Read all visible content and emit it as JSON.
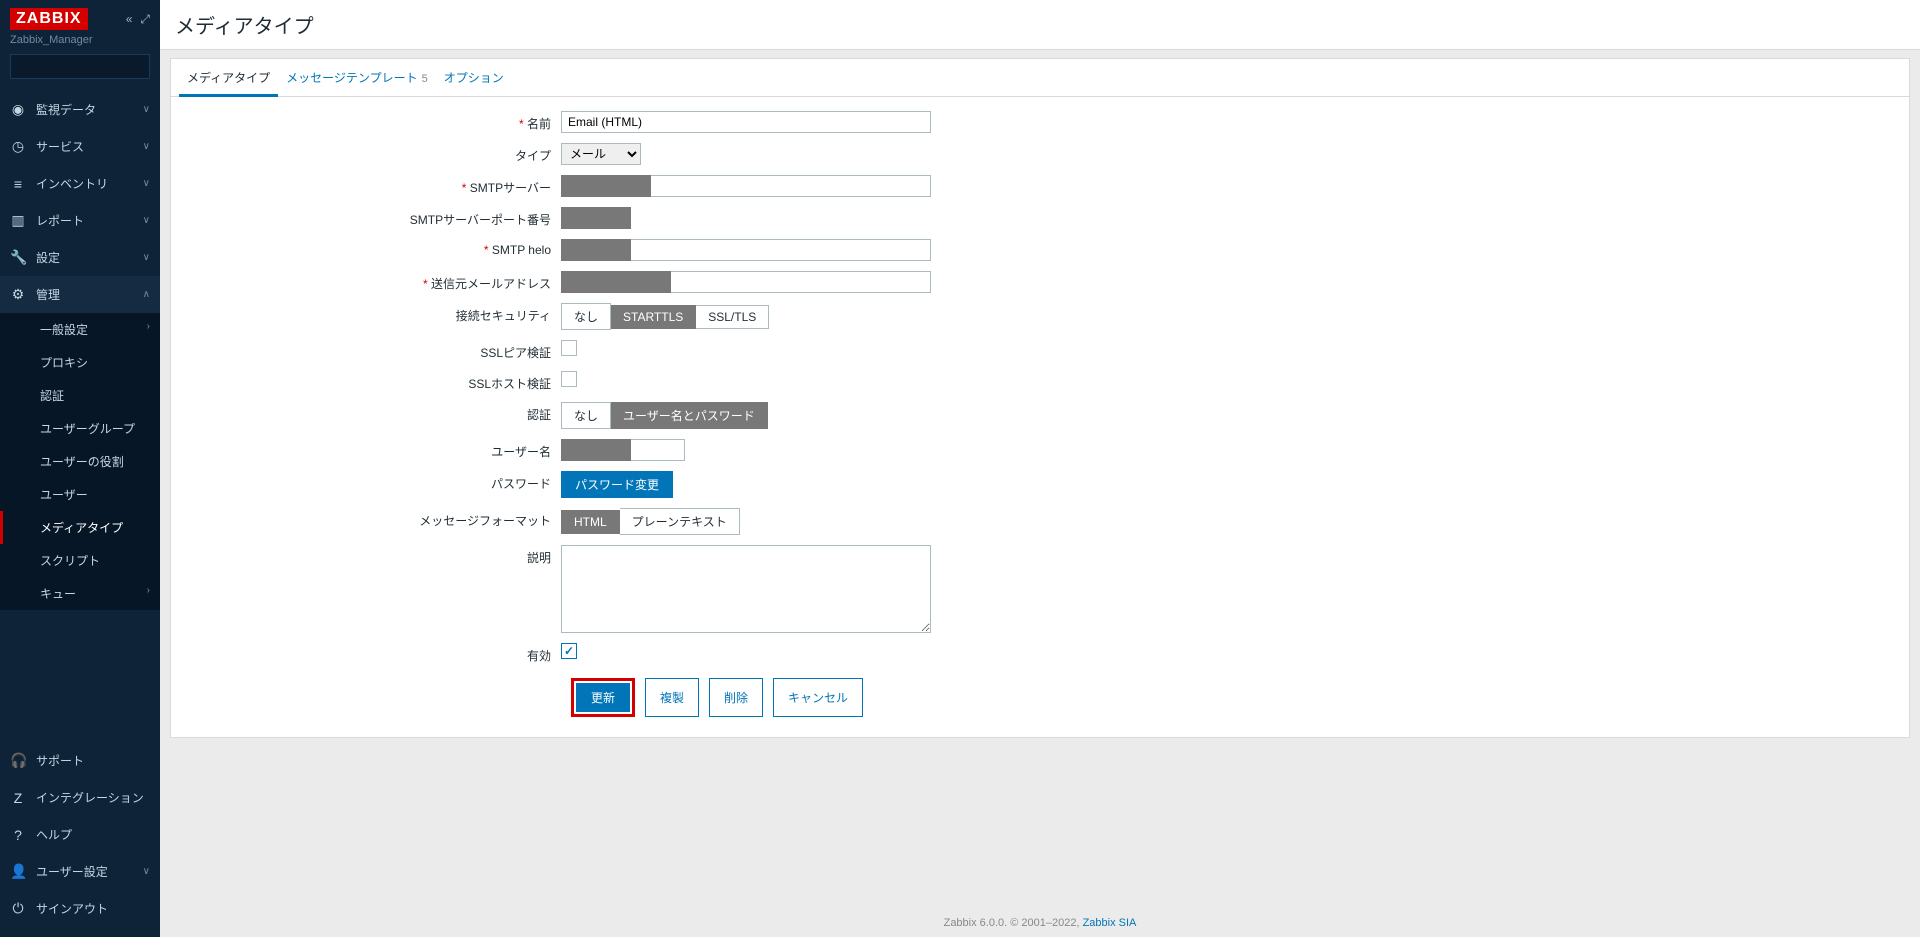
{
  "brand": "ZABBIX",
  "site": "Zabbix_Manager",
  "nav": {
    "monitoring": "監視データ",
    "services": "サービス",
    "inventory": "インベントリ",
    "reports": "レポート",
    "configuration": "設定",
    "administration": "管理"
  },
  "submenu": {
    "general": "一般設定",
    "proxies": "プロキシ",
    "authentication": "認証",
    "usergroups": "ユーザーグループ",
    "userroles": "ユーザーの役割",
    "users": "ユーザー",
    "mediatypes": "メディアタイプ",
    "scripts": "スクリプト",
    "queue": "キュー"
  },
  "sidefoot": {
    "support": "サポート",
    "integrations": "インテグレーション",
    "help": "ヘルプ",
    "usersettings": "ユーザー設定",
    "signout": "サインアウト"
  },
  "page": {
    "title": "メディアタイプ"
  },
  "tabs": {
    "mediatype": "メディアタイプ",
    "templates": "メッセージテンプレート",
    "templates_count": "5",
    "options": "オプション"
  },
  "form": {
    "name_label": "名前",
    "name_value": "Email (HTML)",
    "type_label": "タイプ",
    "type_value": "メール",
    "smtp_server_label": "SMTPサーバー",
    "smtp_port_label": "SMTPサーバーポート番号",
    "smtp_helo_label": "SMTP helo",
    "smtp_email_label": "送信元メールアドレス",
    "conn_sec_label": "接続セキュリティ",
    "conn_none": "なし",
    "conn_starttls": "STARTTLS",
    "conn_ssltls": "SSL/TLS",
    "ssl_peer_label": "SSLピア検証",
    "ssl_host_label": "SSLホスト検証",
    "auth_label": "認証",
    "auth_none": "なし",
    "auth_userpass": "ユーザー名とパスワード",
    "username_label": "ユーザー名",
    "password_label": "パスワード",
    "password_change": "パスワード変更",
    "format_label": "メッセージフォーマット",
    "format_html": "HTML",
    "format_plain": "プレーンテキスト",
    "description_label": "説明",
    "enabled_label": "有効"
  },
  "actions": {
    "update": "更新",
    "clone": "複製",
    "delete": "削除",
    "cancel": "キャンセル"
  },
  "footer": {
    "text": "Zabbix 6.0.0. © 2001–2022, ",
    "link": "Zabbix SIA"
  }
}
